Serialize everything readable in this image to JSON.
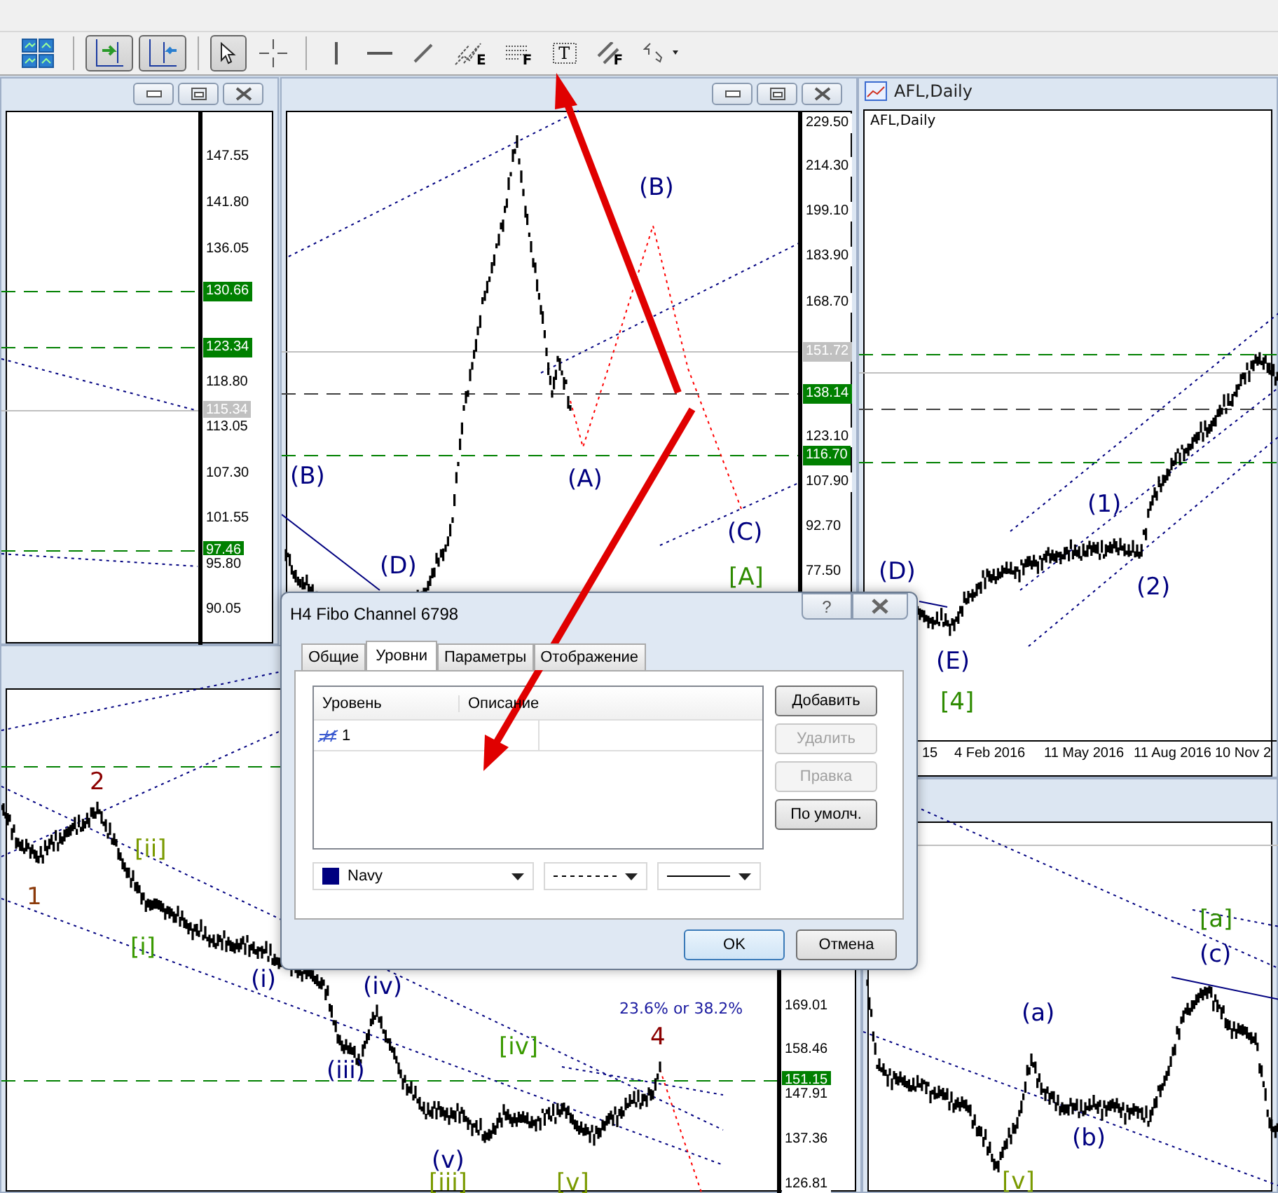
{
  "toolbar": [
    {
      "kind": "tile",
      "selected": false
    },
    {
      "kind": "shift",
      "selected": true
    },
    {
      "kind": "autoscroll",
      "selected": true
    },
    {
      "kind": "cursor",
      "selected": true
    },
    {
      "kind": "crosshair",
      "selected": false
    },
    {
      "kind": "vline",
      "selected": false
    },
    {
      "kind": "hline",
      "selected": false
    },
    {
      "kind": "trend",
      "selected": false
    },
    {
      "kind": "fibo-expansion",
      "selected": false,
      "letter": "E"
    },
    {
      "kind": "fibo-grid",
      "selected": false,
      "letter": "F"
    },
    {
      "kind": "text",
      "selected": false,
      "letter": "T"
    },
    {
      "kind": "fibo-channel",
      "selected": false,
      "letter": "F"
    },
    {
      "kind": "arrows",
      "selected": false
    }
  ],
  "chart_windows": [
    {
      "price_axis": [
        {
          "text": "147.55",
          "kind": "tick"
        },
        {
          "text": "141.80",
          "kind": "tick"
        },
        {
          "text": "136.05",
          "kind": "tick"
        },
        {
          "text": "130.66",
          "kind": "tag",
          "color": "#008000"
        },
        {
          "text": "123.34",
          "kind": "tag",
          "color": "#008000"
        },
        {
          "text": "118.80",
          "kind": "tick"
        },
        {
          "text": "115.34",
          "kind": "tag",
          "color": "#c0c0c0"
        },
        {
          "text": "113.05",
          "kind": "tick"
        },
        {
          "text": "107.30",
          "kind": "tick"
        },
        {
          "text": "101.55",
          "kind": "tick"
        },
        {
          "text": "97.46",
          "kind": "tag",
          "color": "#008000"
        },
        {
          "text": "95.80",
          "kind": "tick"
        },
        {
          "text": "90.05",
          "kind": "tick"
        }
      ]
    },
    {
      "price_axis": [
        {
          "text": "229.50",
          "kind": "tick"
        },
        {
          "text": "214.30",
          "kind": "tick"
        },
        {
          "text": "199.10",
          "kind": "tick"
        },
        {
          "text": "183.90",
          "kind": "tick"
        },
        {
          "text": "168.70",
          "kind": "tick"
        },
        {
          "text": "151.72",
          "kind": "tag",
          "color": "#c0c0c0"
        },
        {
          "text": "138.14",
          "kind": "tag",
          "color": "#008000"
        },
        {
          "text": "123.10",
          "kind": "tick"
        },
        {
          "text": "116.70",
          "kind": "tag",
          "color": "#008000"
        },
        {
          "text": "107.90",
          "kind": "tick"
        },
        {
          "text": "92.70",
          "kind": "tick"
        },
        {
          "text": "77.50",
          "kind": "tick"
        }
      ],
      "wave_labels": [
        {
          "text": "(B)",
          "color": "#000080"
        },
        {
          "text": "(D)",
          "color": "#000080"
        },
        {
          "text": "(B)",
          "color": "#000080"
        },
        {
          "text": "(A)",
          "color": "#000080"
        },
        {
          "text": "(C)",
          "color": "#000080"
        },
        {
          "text": "[A]",
          "color": "#2e8b00"
        }
      ]
    },
    {
      "title": "AFL,Daily",
      "chart_label": "AFL,Daily",
      "date_axis": [
        "15",
        "4 Feb 2016",
        "11 May 2016",
        "11 Aug 2016",
        "10 Nov 2"
      ],
      "wave_labels": [
        {
          "text": "(D)",
          "color": "#000080"
        },
        {
          "text": "(E)",
          "color": "#000080"
        },
        {
          "text": "[4]",
          "color": "#2e8b00"
        },
        {
          "text": "(1)",
          "color": "#000080"
        },
        {
          "text": "(2)",
          "color": "#000080"
        }
      ]
    },
    {
      "price_axis": [
        {
          "text": "169.01",
          "kind": "tick"
        },
        {
          "text": "158.46",
          "kind": "tick"
        },
        {
          "text": "151.15",
          "kind": "tag",
          "color": "#008000"
        },
        {
          "text": "147.91",
          "kind": "tick"
        },
        {
          "text": "137.36",
          "kind": "tick"
        },
        {
          "text": "126.81",
          "kind": "tick"
        }
      ],
      "wave_labels": [
        {
          "text": "2",
          "color": "#8b0000"
        },
        {
          "text": "[ii]",
          "color": "#7a9a00"
        },
        {
          "text": "1",
          "color": "#8b3a0a"
        },
        {
          "text": "[i]",
          "color": "#3a9a00"
        },
        {
          "text": "(i)",
          "color": "#000080"
        },
        {
          "text": "(iv)",
          "color": "#000080"
        },
        {
          "text": "(iii)",
          "color": "#000080"
        },
        {
          "text": "[iv]",
          "color": "#3a9a00"
        },
        {
          "text": "(v)",
          "color": "#000080"
        },
        {
          "text": "[iii]",
          "color": "#7a9a00"
        },
        {
          "text": "[v]",
          "color": "#7a9a00"
        },
        {
          "text": "23.6% or 38.2%",
          "color": "#1a1aa0"
        },
        {
          "text": "4",
          "color": "#8b0000"
        }
      ]
    },
    {
      "wave_labels": [
        {
          "text": "[a]",
          "color": "#2e8b00"
        },
        {
          "text": "(c)",
          "color": "#000080"
        },
        {
          "text": "(a)",
          "color": "#000080"
        },
        {
          "text": "(b)",
          "color": "#000080"
        },
        {
          "text": "[v]",
          "color": "#7a9a00"
        }
      ]
    }
  ],
  "dialog": {
    "title": "H4 Fibo Channel 6798",
    "help": "?",
    "tabs": [
      {
        "label": "Общие",
        "selected": false
      },
      {
        "label": "Уровни",
        "selected": true
      },
      {
        "label": "Параметры",
        "selected": false
      },
      {
        "label": "Отображение",
        "selected": false
      }
    ],
    "columns": [
      "Уровень",
      "Описание"
    ],
    "rows": [
      {
        "level": "1"
      }
    ],
    "side_buttons": [
      {
        "label": "Добавить",
        "disabled": false
      },
      {
        "label": "Удалить",
        "disabled": true
      },
      {
        "label": "Правка",
        "disabled": true
      },
      {
        "label": "По умолч.",
        "disabled": false
      }
    ],
    "color": {
      "label": "Navy"
    },
    "line_styles": [
      {
        "kind": "dashed"
      },
      {
        "kind": "solid"
      }
    ],
    "buttons": [
      {
        "label": "OK",
        "default": true
      },
      {
        "label": "Отмена",
        "default": false
      }
    ]
  }
}
